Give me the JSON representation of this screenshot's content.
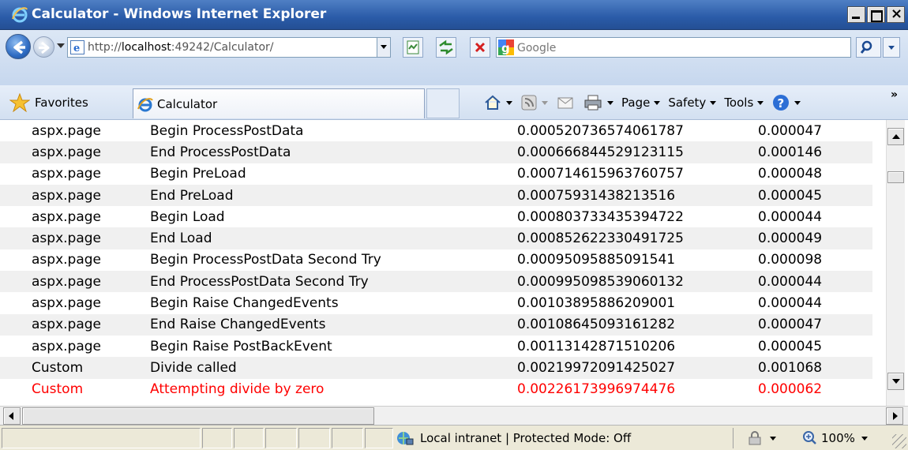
{
  "window": {
    "title": "Calculator - Windows Internet Explorer"
  },
  "address_bar": {
    "url_prefix": "http://",
    "url_host": "localhost",
    "url_rest": ":49242/Calculator/",
    "search_placeholder": "Google"
  },
  "command_bar": {
    "favorites_label": "Favorites",
    "tab_label": "Calculator",
    "page_label": "Page",
    "safety_label": "Safety",
    "tools_label": "Tools",
    "overflow": "»"
  },
  "trace_rows": [
    {
      "category": "aspx.page",
      "message": "Begin ProcessPostData",
      "from_first": "0.000520736574061787",
      "from_last": "0.000047",
      "warn": false
    },
    {
      "category": "aspx.page",
      "message": "End ProcessPostData",
      "from_first": "0.000666844529123115",
      "from_last": "0.000146",
      "warn": false
    },
    {
      "category": "aspx.page",
      "message": "Begin PreLoad",
      "from_first": "0.000714615963760757",
      "from_last": "0.000048",
      "warn": false
    },
    {
      "category": "aspx.page",
      "message": "End PreLoad",
      "from_first": "0.00075931438213516",
      "from_last": "0.000045",
      "warn": false
    },
    {
      "category": "aspx.page",
      "message": "Begin Load",
      "from_first": "0.000803733435394722",
      "from_last": "0.000044",
      "warn": false
    },
    {
      "category": "aspx.page",
      "message": "End Load",
      "from_first": "0.000852622330491725",
      "from_last": "0.000049",
      "warn": false
    },
    {
      "category": "aspx.page",
      "message": "Begin ProcessPostData Second Try",
      "from_first": "0.00095095885091541",
      "from_last": "0.000098",
      "warn": false
    },
    {
      "category": "aspx.page",
      "message": "End ProcessPostData Second Try",
      "from_first": "0.000995098539060132",
      "from_last": "0.000044",
      "warn": false
    },
    {
      "category": "aspx.page",
      "message": "Begin Raise ChangedEvents",
      "from_first": "0.00103895886209001",
      "from_last": "0.000044",
      "warn": false
    },
    {
      "category": "aspx.page",
      "message": "End Raise ChangedEvents",
      "from_first": "0.00108645093161282",
      "from_last": "0.000047",
      "warn": false
    },
    {
      "category": "aspx.page",
      "message": "Begin Raise PostBackEvent",
      "from_first": "0.00113142871510206",
      "from_last": "0.000045",
      "warn": false
    },
    {
      "category": "Custom",
      "message": "Divide called",
      "from_first": "0.00219972091425027",
      "from_last": "0.001068",
      "warn": false
    },
    {
      "category": "Custom",
      "message": "Attempting divide by zero",
      "from_first": "0.00226173996974476",
      "from_last": "0.000062",
      "warn": true
    }
  ],
  "status_bar": {
    "zone_text": "Local intranet | Protected Mode: Off",
    "zoom_text": "100%"
  },
  "colors": {
    "warning_text": "#ff0000",
    "alt_row": "#f0f0f0"
  }
}
